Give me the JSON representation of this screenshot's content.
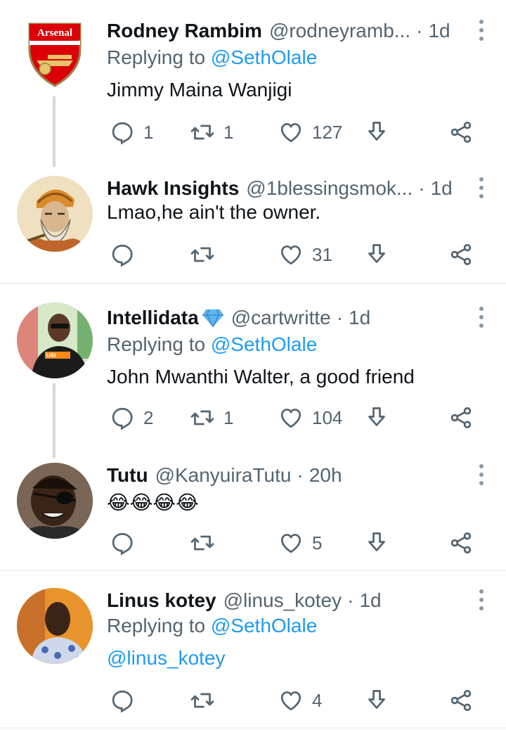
{
  "tweets": [
    {
      "name": "Rodney Rambim",
      "handle": "@rodneyramb...",
      "sep": "·",
      "time": "1d",
      "replying_label": "Replying to",
      "replying_to": "@SethOlale",
      "text": "Jimmy Maina Wanjigi",
      "replies": "1",
      "retweets": "1",
      "likes": "127",
      "avatar": "arsenal-crest",
      "avatar_text": "Arsenal"
    },
    {
      "name": "Hawk Insights",
      "handle": "@1blessingsmok...",
      "sep": "·",
      "time": "1d",
      "text": "Lmao,he ain't the owner.",
      "replies": "",
      "retweets": "",
      "likes": "31",
      "avatar": "bearded-figure-painting"
    },
    {
      "name": "Intellidata",
      "handle": "@cartwritte",
      "sep": "·",
      "time": "1d",
      "replying_label": "Replying to",
      "replying_to": "@SethOlale",
      "text": "John Mwanthi Walter, a good friend",
      "replies": "2",
      "retweets": "1",
      "likes": "104",
      "avatar": "man-in-sunglasses",
      "badge": "diamond-emoji"
    },
    {
      "name": "Tutu",
      "handle": "@KanyuiraTutu",
      "sep": "·",
      "time": "20h",
      "text": "😂😂😂😂",
      "replies": "",
      "retweets": "",
      "likes": "5",
      "avatar": "man-with-eyepatch"
    },
    {
      "name": "Linus kotey",
      "handle": "@linus_kotey",
      "sep": "·",
      "time": "1d",
      "replying_label": "Replying to",
      "replying_to": "@SethOlale",
      "text": "@linus_kotey",
      "replies": "",
      "retweets": "",
      "likes": "4",
      "avatar": "man-in-floral-shirt"
    }
  ],
  "icons": {
    "reply": "reply-icon",
    "retweet": "retweet-icon",
    "like": "heart-icon",
    "download": "download-icon",
    "share": "share-icon",
    "more": "more-dots-icon"
  },
  "colors": {
    "link": "#1d9bf0",
    "muted": "#536471",
    "thread_line": "#cfd9de",
    "divider": "#eff3f4"
  }
}
